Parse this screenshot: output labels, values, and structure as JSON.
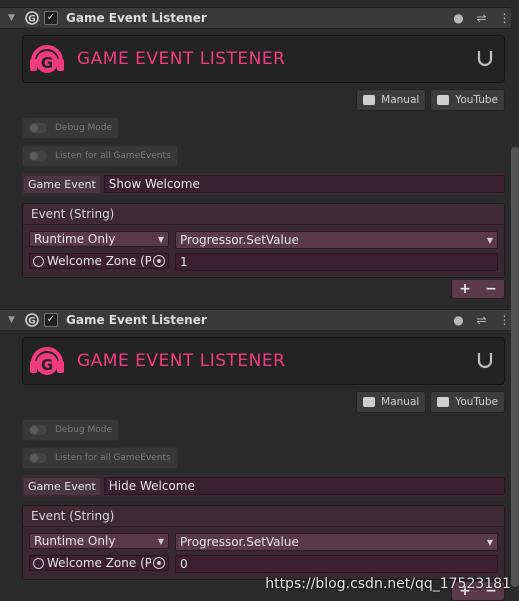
{
  "components": [
    {
      "title": "Game Event Listener",
      "banner_title": "GAME EVENT LISTENER",
      "manual_label": "Manual",
      "youtube_label": "YouTube",
      "debug_label": "Debug Mode",
      "listen_all_label": "Listen for all GameEvents",
      "game_event_label": "Game Event",
      "game_event_value": "Show Welcome",
      "event_type_label": "Event (String)",
      "runtime_label": "Runtime Only",
      "method_label": "Progressor.SetValue",
      "target_label": "Welcome Zone (Progressor)",
      "arg_value": "1"
    },
    {
      "title": "Game Event Listener",
      "banner_title": "GAME EVENT LISTENER",
      "manual_label": "Manual",
      "youtube_label": "YouTube",
      "debug_label": "Debug Mode",
      "listen_all_label": "Listen for all GameEvents",
      "game_event_label": "Game Event",
      "game_event_value": "Hide Welcome",
      "event_type_label": "Event (String)",
      "runtime_label": "Runtime Only",
      "method_label": "Progressor.SetValue",
      "target_label": "Welcome Zone (Progressor)",
      "arg_value": "0"
    }
  ],
  "header_icons": [
    "help-icon",
    "presets-icon",
    "more-menu-icon"
  ],
  "watermark": "https://blog.csdn.net/qq_17523181",
  "colors": {
    "accent": "#f03c7c",
    "event_bg": "#3e2a33",
    "dropdown_bg": "#5a3a48"
  }
}
